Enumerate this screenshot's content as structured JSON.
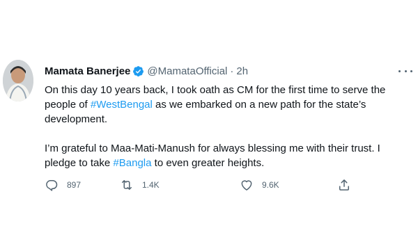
{
  "tweet": {
    "author_name": "Mamata Banerjee",
    "handle": "@MamataOfficial",
    "separator": "·",
    "time": "2h",
    "text": {
      "p1_part1": "On this day 10 years back, I took oath as CM for the first time to serve the people of ",
      "p1_hashtag": "#WestBengal",
      "p1_part2": " as we embarked on a new path for the state’s development.",
      "p2_part1": "I’m grateful to Maa-Mati-Manush for always blessing me with their trust. I pledge to take ",
      "p2_hashtag": "#Bangla",
      "p2_part2": " to even greater heights."
    },
    "stats": {
      "replies": "897",
      "retweets": "1.4K",
      "likes": "9.6K"
    }
  },
  "icons": {
    "verified": "verified-badge-icon",
    "more": "more-horizontal-icon",
    "reply": "reply-icon",
    "retweet": "retweet-icon",
    "like": "heart-icon",
    "share": "share-icon"
  },
  "colors": {
    "accent": "#1d9bf0",
    "text": "#0f1419",
    "muted": "#536471"
  }
}
